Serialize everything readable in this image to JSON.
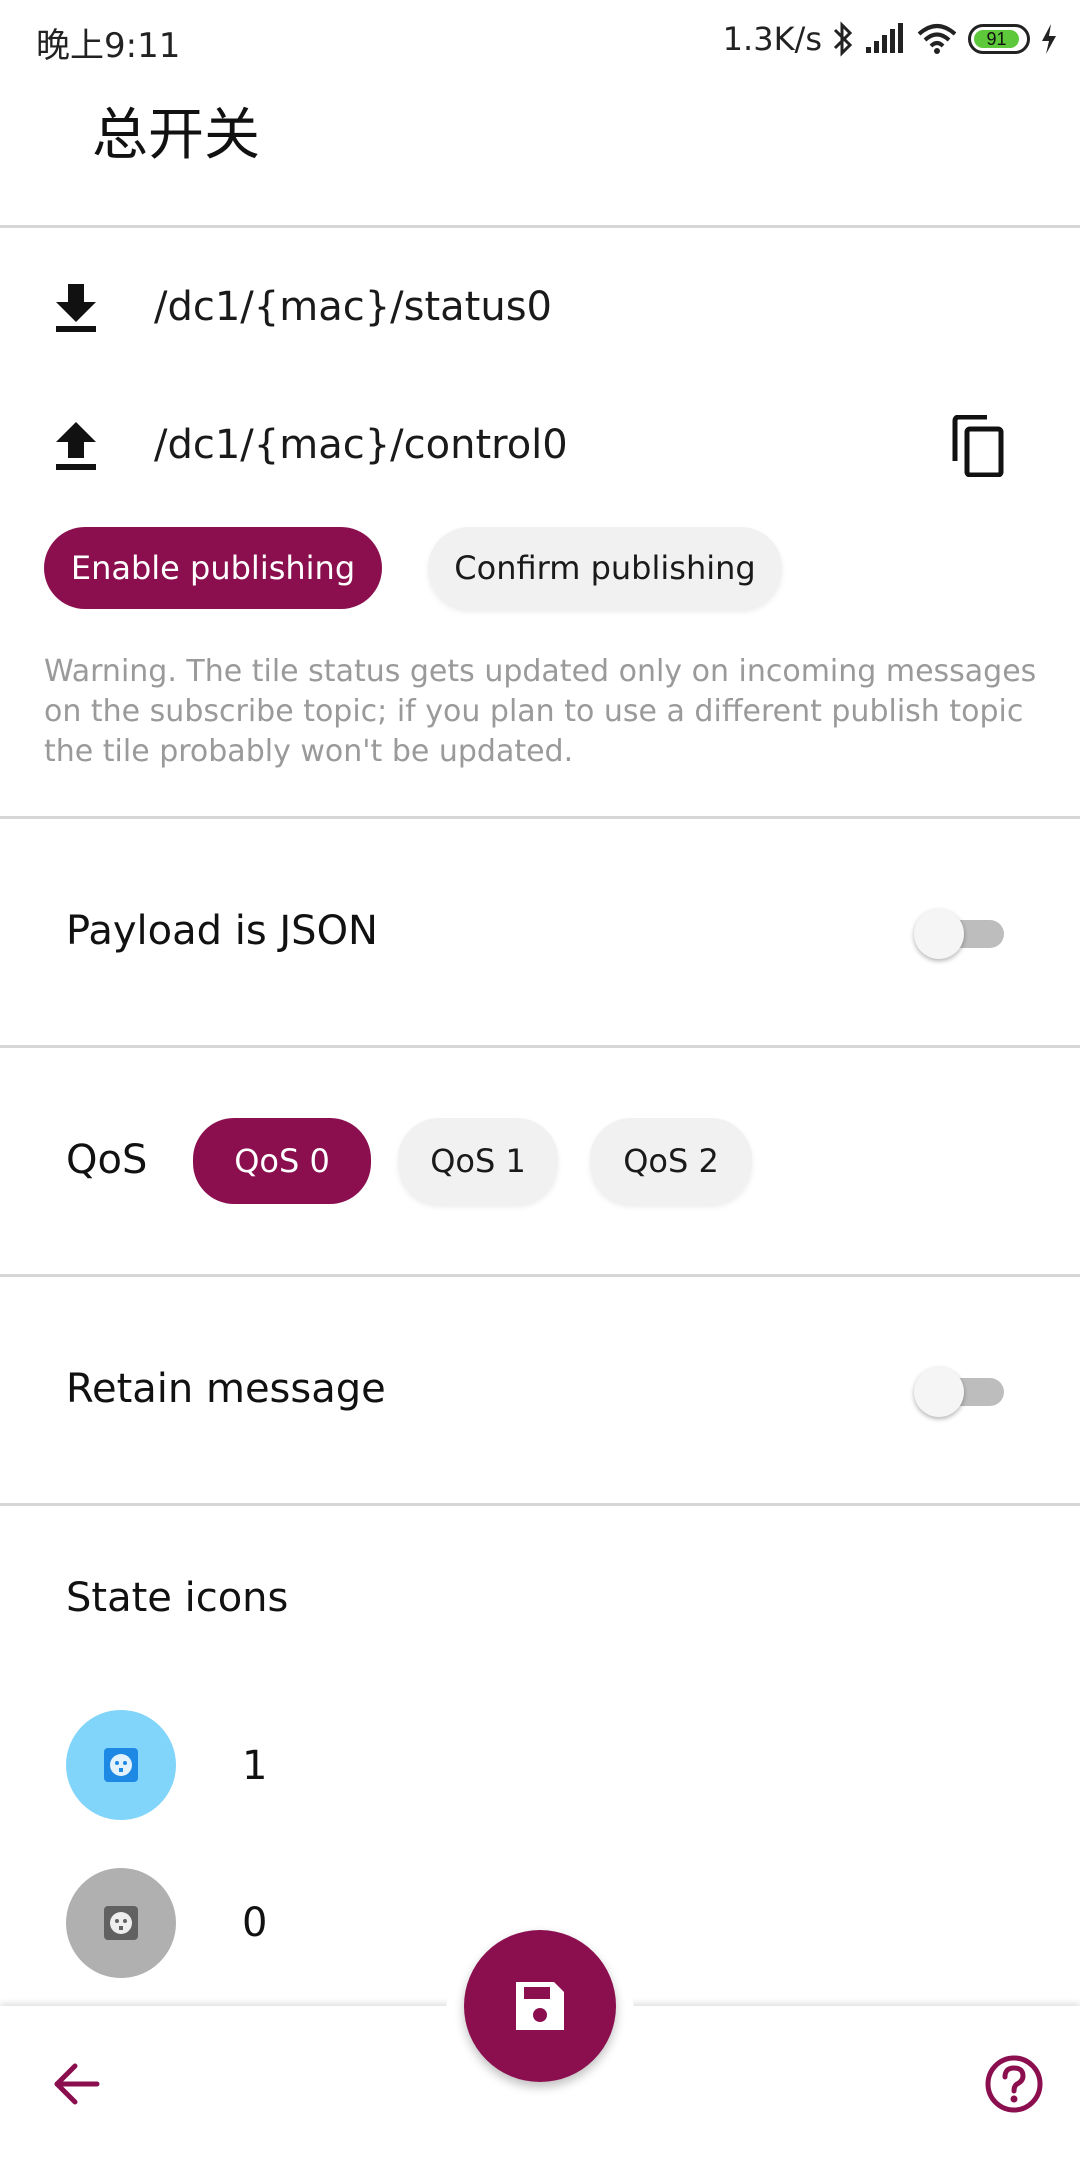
{
  "status_bar": {
    "time": "晚上9:11",
    "network_speed": "1.3K/s",
    "battery_level": "91",
    "icons": [
      "bluetooth-icon",
      "signal-icon",
      "wifi-icon",
      "battery-icon",
      "charging-icon"
    ]
  },
  "header": {
    "title": "总开关"
  },
  "topics": {
    "subscribe": {
      "icon": "download-icon",
      "value": "/dc1/{mac}/status0"
    },
    "publish": {
      "icon": "upload-icon",
      "value": "/dc1/{mac}/control0",
      "copy_icon": "copy-icon"
    }
  },
  "publishing": {
    "enable_label": "Enable publishing",
    "confirm_label": "Confirm publishing",
    "warning": "Warning. The tile status gets updated only on incoming messages on the subscribe topic; if you plan to use a different publish topic the tile probably won't be updated."
  },
  "payload_json": {
    "label": "Payload is JSON",
    "enabled": false
  },
  "qos": {
    "label": "QoS",
    "options": [
      "QoS 0",
      "QoS 1",
      "QoS 2"
    ],
    "selected": "QoS 0"
  },
  "retain": {
    "label": "Retain message",
    "enabled": false
  },
  "state_icons": {
    "label": "State icons",
    "items": [
      {
        "icon": "outlet-icon",
        "value": "1",
        "color": "#81d4fa"
      },
      {
        "icon": "outlet-icon",
        "value": "0",
        "color": "#b0b0b0"
      }
    ]
  },
  "bottom_bar": {
    "back_icon": "arrow-back-icon",
    "save_icon": "save-icon",
    "help_icon": "help-icon"
  },
  "colors": {
    "accent": "#8b0f4f",
    "divider": "#d6d6d6",
    "warning_text": "#9a9a9a"
  }
}
